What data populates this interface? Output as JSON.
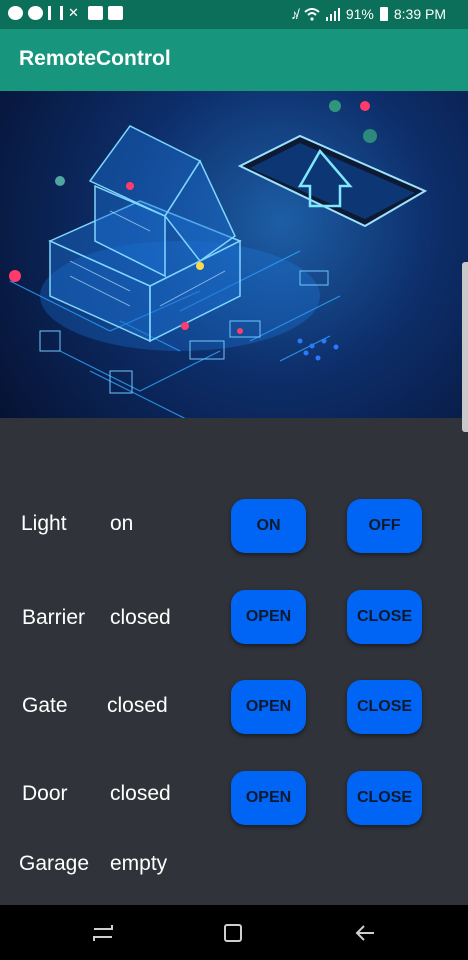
{
  "status_bar": {
    "battery": "91%",
    "time": "8:39 PM",
    "left_icons": [
      "messenger-icon",
      "messenger-icon",
      "notification-icon",
      "mute-icon",
      "image-icon",
      "on-badge-icon"
    ],
    "right_icons": [
      "mute-icon",
      "wifi-icon",
      "signal-icon",
      "battery-icon"
    ]
  },
  "app_bar": {
    "title": "RemoteControl"
  },
  "hero": {
    "image": "smart-home-house-and-phone-illustration"
  },
  "controls": [
    {
      "name": "Light",
      "status": "on",
      "buttons": [
        "ON",
        "OFF"
      ]
    },
    {
      "name": "Barrier",
      "status": "closed",
      "buttons": [
        "OPEN",
        "CLOSE"
      ]
    },
    {
      "name": "Gate",
      "status": "closed",
      "buttons": [
        "OPEN",
        "CLOSE"
      ]
    },
    {
      "name": "Door",
      "status": "closed",
      "buttons": [
        "OPEN",
        "CLOSE"
      ]
    },
    {
      "name": "Garage",
      "status": "empty",
      "buttons": []
    }
  ],
  "nav_bar": {
    "icons": [
      "recent-apps-icon",
      "home-icon",
      "back-icon"
    ]
  },
  "colors": {
    "status_bar": "#0b6f59",
    "app_bar": "#17967d",
    "background": "#30343a",
    "button": "#0064f4",
    "button_text": "#0d1a2e"
  }
}
